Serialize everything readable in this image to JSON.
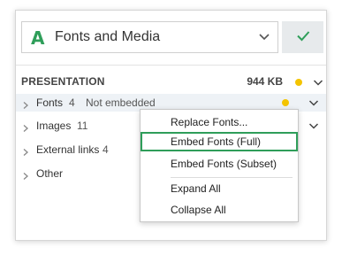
{
  "header": {
    "logo_letter": "A",
    "title": "Fonts and Media"
  },
  "section": {
    "title": "PRESENTATION",
    "size": "944 KB"
  },
  "rows": [
    {
      "label": "Fonts",
      "count": "4",
      "status": "Not embedded"
    },
    {
      "label": "Images",
      "count": "11"
    },
    {
      "label": "External links",
      "count": "4"
    },
    {
      "label": "Other"
    }
  ],
  "menu": {
    "items": [
      "Replace Fonts...",
      "Embed Fonts (Full)",
      "Embed Fonts (Subset)",
      "Expand All",
      "Collapse All"
    ]
  },
  "colors": {
    "accent": "#2f9e5a",
    "warning_dot": "#f4c400",
    "highlight_row": "#eef2f6"
  },
  "icons": {
    "logo": "font-a-icon",
    "dropdown": "chevron-down-icon",
    "confirm": "checkmark-icon",
    "expand": "chevron-right-icon",
    "status": "status-dot-icon"
  }
}
